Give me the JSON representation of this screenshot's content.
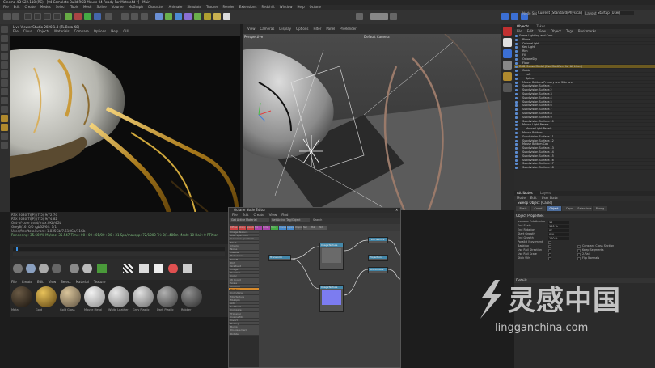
{
  "app": {
    "title": "Cinema 4D S22.118 (RC) - [04 Complete Build RGB Mouse 04 Ready For Mats.c4d *] - Main"
  },
  "menubar": [
    "File",
    "Edit",
    "Create",
    "Modes",
    "Select",
    "Tools",
    "Mesh",
    "Spline",
    "Volume",
    "MoGraph",
    "Character",
    "Animate",
    "Simulate",
    "Tracker",
    "Render",
    "Extensions",
    "Redshift",
    "Window",
    "Help",
    "Octane"
  ],
  "toolbar": {
    "node_space_label": "Node Space:",
    "node_space_value": "Current (Standard/Physical)",
    "layout_label": "Layout:",
    "layout_value": "Startup (User)"
  },
  "picture_viewer": {
    "title": "Live Viewer Studio 2020.1.4 (TL-Beta-K8)",
    "menu": [
      "File",
      "Cloud",
      "Objects",
      "Materials",
      "Compare",
      "Options",
      "Help",
      "GUI"
    ]
  },
  "viewport": {
    "menu": [
      "View",
      "Cameras",
      "Display",
      "Options",
      "Filter",
      "Panel",
      "ProRender"
    ],
    "label": "Perspective",
    "camera": "Default Camera"
  },
  "status_info": {
    "lines": [
      "RTX 2080 TI[P] (7.5)     9/72     76",
      "RTX 2080 TI[P] (7.5)     9/74     82",
      "Out-of-core used/max:0Kb/4Gb",
      "Grey8/16: 0/0       rgb32/64: 1/1",
      "Used/free/total vram: 1.835Gb/7.518Gb/11Gb"
    ],
    "rendering_text": "Rendering: 35.669%   Ms/sec: 35.547   Time: 00 : 00 : 01/00 : 00 : 31   Spp/maxspp: 72/1000   Tri: 0/1.486m   Mesh: 10   Hair: 0   RTX:on"
  },
  "materials": {
    "menu": [
      "File",
      "Create",
      "Edit",
      "View",
      "Select",
      "Material",
      "Texture"
    ],
    "items": [
      {
        "name": "Metal",
        "color_a": "#6a5a45",
        "color_b": "#1a140e"
      },
      {
        "name": "Gold",
        "color_a": "#e8c25a",
        "color_b": "#5a4010"
      },
      {
        "name": "Gold Gloss",
        "color_a": "#d9c49a",
        "color_b": "#5c5040"
      },
      {
        "name": "Mouse Metal",
        "color_a": "#f2f2f2",
        "color_b": "#8a8a8a"
      },
      {
        "name": "White Leather",
        "color_a": "#e8e8e8",
        "color_b": "#7a7a7a"
      },
      {
        "name": "Grey Plastic",
        "color_a": "#e0e0e0",
        "color_b": "#6a6a6a"
      },
      {
        "name": "Dark Plastic",
        "color_a": "#b0b0b0",
        "color_b": "#3a3a3a"
      },
      {
        "name": "Rubber",
        "color_a": "#909090",
        "color_b": "#2a2a2a"
      }
    ]
  },
  "node_editor": {
    "title": "Octane Node Editor",
    "menu": [
      "File",
      "Edit",
      "Create",
      "View",
      "Find"
    ],
    "tabs": [
      "Get Active Material",
      "Get Active Tag/Object"
    ],
    "search_label": "Search",
    "categories": [
      "Diffuse",
      "Glossy",
      "Specular",
      "Mix",
      "Portal",
      "Toon",
      "Universal",
      "Layered",
      "Clipping",
      "Null",
      "Mat",
      "Std"
    ],
    "left_list": [
      "Image Texture",
      "RGB Spectrum",
      "Gaussian spectrum",
      "Float",
      "Checks",
      "Noise",
      "Marble",
      "Turbulence",
      "Falloff",
      "Dirt",
      "Gradient",
      "Image",
      "Random",
      "Color",
      "W Coord",
      "Scale",
      "Uniform",
      "Position",
      "Cylindrical",
      "Mix Texture",
      "Multiply",
      "Add",
      "Subtract",
      "Compare",
      "Triplanar",
      "Cosine Mix",
      "Invert",
      "Baking",
      "Bump",
      "Displacement",
      "Rotate"
    ],
    "selected_index": 17,
    "nodes": [
      {
        "title": "Transform",
        "color": "#4a7fbf"
      },
      {
        "title": "ImageTexture",
        "color": "#4a7fbf"
      },
      {
        "title": "ImageTexture",
        "color": "#4a7fbf"
      },
      {
        "title": "FloatTexture",
        "color": "#4a7fbf"
      },
      {
        "title": "Projection",
        "color": "#4a7fbf"
      },
      {
        "title": "Std Surface",
        "color": "#4a7fbf"
      }
    ]
  },
  "objects": {
    "tabs": [
      "Objects",
      "Takes"
    ],
    "menu": [
      "File",
      "Edit",
      "View",
      "Object",
      "Tags",
      "Bookmarks"
    ],
    "rows": [
      {
        "label": "Scene Lighting and Cam",
        "level": 0,
        "state": ""
      },
      {
        "label": "Plane",
        "level": 1,
        "state": ""
      },
      {
        "label": "OctaneLight",
        "level": 1,
        "state": ""
      },
      {
        "label": "Key Light",
        "level": 1,
        "state": ""
      },
      {
        "label": "Rim",
        "level": 1,
        "state": ""
      },
      {
        "label": "Fill",
        "level": 1,
        "state": ""
      },
      {
        "label": "OctaneSky",
        "level": 1,
        "state": ""
      },
      {
        "label": "Floor",
        "level": 1,
        "state": ""
      },
      {
        "label": "RGB Mouse Model (Use Modifiers for All Lines)",
        "level": 0,
        "state": "hl"
      },
      {
        "label": "Cable",
        "level": 1,
        "state": ""
      },
      {
        "label": "Loft",
        "level": 2,
        "state": ""
      },
      {
        "label": "Spline",
        "level": 2,
        "state": ""
      },
      {
        "label": "Mouse Buttons Primary and Side and",
        "level": 1,
        "state": ""
      },
      {
        "label": "Subdivision Surface.1",
        "level": 1,
        "state": ""
      },
      {
        "label": "Subdivision Surface.2",
        "level": 1,
        "state": ""
      },
      {
        "label": "Subdivision Surface.3",
        "level": 1,
        "state": ""
      },
      {
        "label": "Subdivision Surface.4",
        "level": 1,
        "state": ""
      },
      {
        "label": "Subdivision Surface.5",
        "level": 1,
        "state": ""
      },
      {
        "label": "Subdivision Surface.6",
        "level": 1,
        "state": ""
      },
      {
        "label": "Subdivision Surface.7",
        "level": 1,
        "state": ""
      },
      {
        "label": "Subdivision Surface.8",
        "level": 1,
        "state": ""
      },
      {
        "label": "Subdivision Surface.9",
        "level": 1,
        "state": ""
      },
      {
        "label": "Subdivision Surface.10",
        "level": 1,
        "state": ""
      },
      {
        "label": "Mouse Light Panels",
        "level": 1,
        "state": ""
      },
      {
        "label": "Mouse Light Panels",
        "level": 2,
        "state": ""
      },
      {
        "label": "Mouse Bottom",
        "level": 1,
        "state": ""
      },
      {
        "label": "Subdivision Surface.11",
        "level": 1,
        "state": ""
      },
      {
        "label": "Subdivision Surface.12",
        "level": 1,
        "state": ""
      },
      {
        "label": "Mouse Bottom Cap",
        "level": 1,
        "state": ""
      },
      {
        "label": "Subdivision Surface.13",
        "level": 1,
        "state": ""
      },
      {
        "label": "Subdivision Surface.14",
        "level": 1,
        "state": ""
      },
      {
        "label": "Subdivision Surface.15",
        "level": 1,
        "state": ""
      },
      {
        "label": "Subdivision Surface.16",
        "level": 1,
        "state": ""
      },
      {
        "label": "Subdivision Surface.17",
        "level": 1,
        "state": ""
      },
      {
        "label": "Subdivision Surface.18",
        "level": 1,
        "state": ""
      }
    ]
  },
  "attributes": {
    "tabs": [
      "Attributes",
      "Layers"
    ],
    "menu": [
      "Mode",
      "Edit",
      "User Data"
    ],
    "title": "Sweep Object [Cable]",
    "subtabs": [
      "Basic",
      "Coord.",
      "Object",
      "Caps",
      "Selections",
      "Phong"
    ],
    "active_subtab": 2,
    "section": "Object Properties",
    "props": [
      {
        "label": "Isoparm Subdivision",
        "value": "10",
        "type": "num"
      },
      {
        "label": "End Scale",
        "value": "100 %",
        "type": "num"
      },
      {
        "label": "End Rotation",
        "value": "0°",
        "type": "num"
      },
      {
        "label": "Start Growth",
        "value": "0 %",
        "type": "num"
      },
      {
        "label": "End Growth",
        "value": "100 %",
        "type": "num"
      },
      {
        "label": "Parallel Movement",
        "value": "",
        "type": "chk"
      },
      {
        "label": "Banking",
        "value": "",
        "type": "chk"
      },
      {
        "label": "Use Rail Direction",
        "value": "",
        "type": "chk"
      },
      {
        "label": "Use Rail Scale",
        "value": "",
        "type": "chk"
      },
      {
        "label": "Stick UVs",
        "value": "",
        "type": "chk"
      }
    ],
    "props_right": [
      "Constant Cross Section",
      "Keep Segments",
      "2-Rail",
      "Flip Normals"
    ],
    "details": "Details"
  },
  "watermark": {
    "cn": "灵感中国",
    "en": "lingganchina.com"
  }
}
